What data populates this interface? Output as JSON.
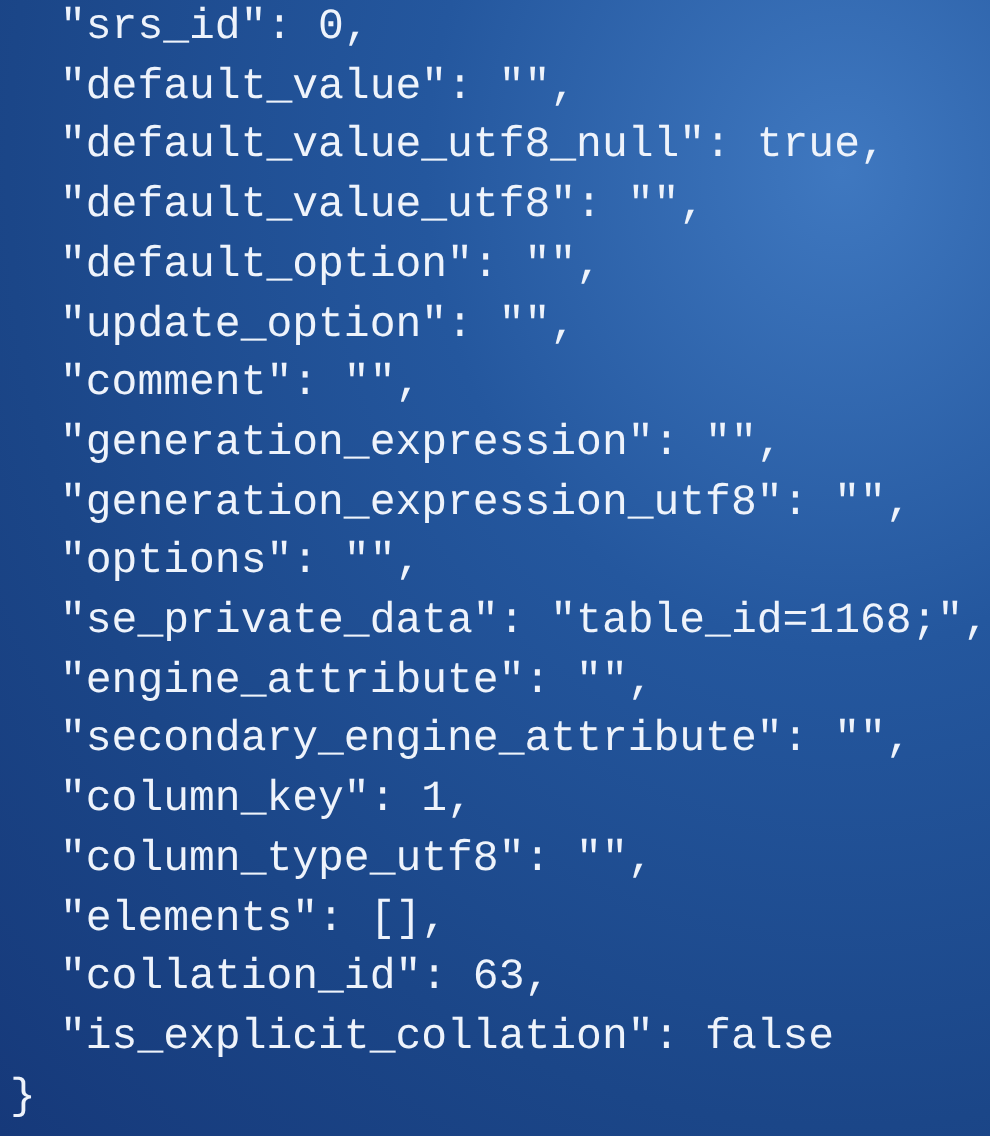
{
  "code_lines": [
    {
      "kind": "entry",
      "text": "\"srs_id\": 0,"
    },
    {
      "kind": "entry",
      "text": "\"default_value\": \"\","
    },
    {
      "kind": "entry",
      "text": "\"default_value_utf8_null\": true,"
    },
    {
      "kind": "entry",
      "text": "\"default_value_utf8\": \"\","
    },
    {
      "kind": "entry",
      "text": "\"default_option\": \"\","
    },
    {
      "kind": "entry",
      "text": "\"update_option\": \"\","
    },
    {
      "kind": "entry",
      "text": "\"comment\": \"\","
    },
    {
      "kind": "entry",
      "text": "\"generation_expression\": \"\","
    },
    {
      "kind": "entry",
      "text": "\"generation_expression_utf8\": \"\","
    },
    {
      "kind": "entry",
      "text": "\"options\": \"\","
    },
    {
      "kind": "entry",
      "text": "\"se_private_data\": \"table_id=1168;\","
    },
    {
      "kind": "entry",
      "text": "\"engine_attribute\": \"\","
    },
    {
      "kind": "entry",
      "text": "\"secondary_engine_attribute\": \"\","
    },
    {
      "kind": "entry",
      "text": "\"column_key\": 1,"
    },
    {
      "kind": "entry",
      "text": "\"column_type_utf8\": \"\","
    },
    {
      "kind": "entry",
      "text": "\"elements\": [],"
    },
    {
      "kind": "entry",
      "text": "\"collation_id\": 63,"
    },
    {
      "kind": "entry",
      "text": "\"is_explicit_collation\": false"
    },
    {
      "kind": "brace",
      "text": "}"
    }
  ]
}
